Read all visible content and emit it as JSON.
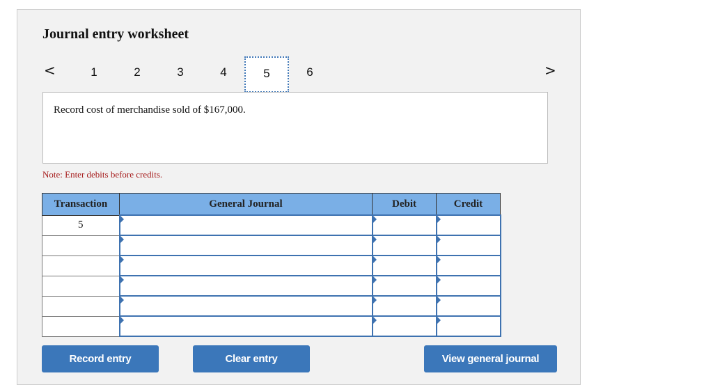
{
  "worksheet": {
    "title": "Journal entry worksheet",
    "nav": {
      "prev_icon": "chevron-left-icon",
      "next_icon": "chevron-right-icon",
      "prev_glyph": "<",
      "next_glyph": ">",
      "tabs": [
        {
          "label": "1",
          "active": false
        },
        {
          "label": "2",
          "active": false
        },
        {
          "label": "3",
          "active": false
        },
        {
          "label": "4",
          "active": false
        },
        {
          "label": "5",
          "active": true
        },
        {
          "label": "6",
          "active": false
        }
      ]
    },
    "description": "Record cost of merchandise sold of $167,000.",
    "note": "Note: Enter debits before credits.",
    "table": {
      "headers": [
        "Transaction",
        "General Journal",
        "Debit",
        "Credit"
      ],
      "rows": [
        {
          "transaction": "5",
          "account": "",
          "debit": "",
          "credit": ""
        },
        {
          "transaction": "",
          "account": "",
          "debit": "",
          "credit": ""
        },
        {
          "transaction": "",
          "account": "",
          "debit": "",
          "credit": ""
        },
        {
          "transaction": "",
          "account": "",
          "debit": "",
          "credit": ""
        },
        {
          "transaction": "",
          "account": "",
          "debit": "",
          "credit": ""
        },
        {
          "transaction": "",
          "account": "",
          "debit": "",
          "credit": ""
        }
      ]
    },
    "buttons": {
      "record": "Record entry",
      "clear": "Clear entry",
      "view": "View general journal"
    }
  },
  "colors": {
    "header_bg": "#7aafe6",
    "button_bg": "#3b77ba",
    "note_color": "#a61c1c",
    "active_tab_border": "#3e76b6"
  }
}
